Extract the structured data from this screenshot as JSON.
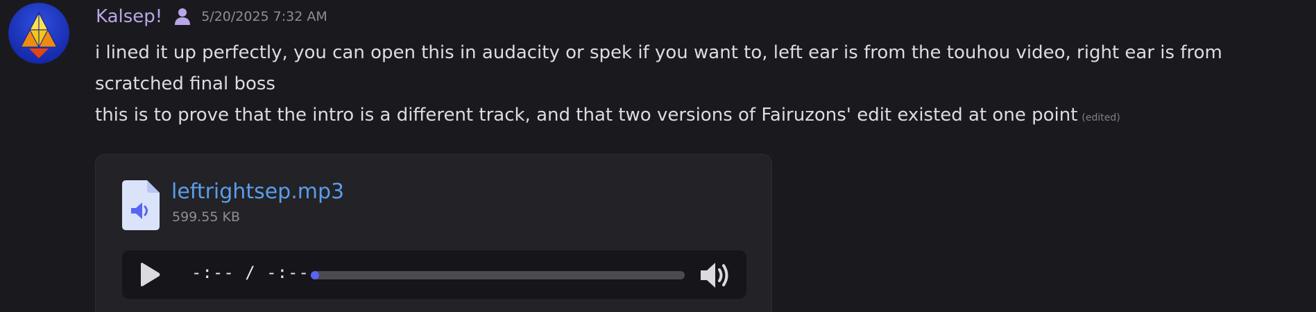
{
  "message": {
    "author": "Kalsep!",
    "timestamp": "5/20/2025 7:32 AM",
    "avatar_icon": "triangle-logo-icon",
    "role_icon": "person-icon",
    "lines": [
      "i lined it up perfectly, you can open this in audacity or spek if you want to, left ear is from the touhou video, right ear is from scratched final boss",
      "this is to prove that the intro is a different track, and that two versions of Fairuzons' edit existed at one point"
    ],
    "edited_label": "(edited)"
  },
  "attachment": {
    "icon": "audio-file-icon",
    "file_name": "leftrightsep.mp3",
    "file_size": "599.55 KB"
  },
  "player": {
    "time": "-:-- / -:--",
    "progress": 0,
    "colors": {
      "accent": "#5865f2"
    }
  },
  "colors": {
    "username": "#b9a6e8",
    "link": "#5b9de8",
    "background": "#1a1a1e"
  }
}
